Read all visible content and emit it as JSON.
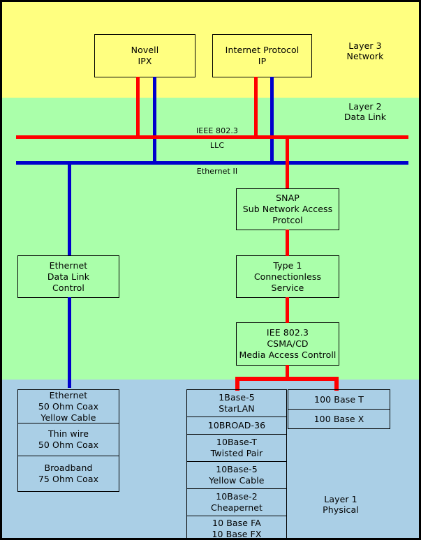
{
  "diagram": {
    "title": "Ethernet / IEEE 802.3 protocol stack",
    "colors": {
      "layer3_band": "#ffff80",
      "layer2_band": "#aaffaa",
      "layer1_band": "#aacfe6",
      "ieee8023_bus": "#ff0000",
      "ethernetII_bus": "#0000cc",
      "box_border": "#000000"
    }
  },
  "layers": [
    {
      "id": "layer3",
      "label": "Layer 3\nNetwork"
    },
    {
      "id": "layer2",
      "label": "Layer 2\nData Link"
    },
    {
      "id": "layer1",
      "label": "Layer 1\nPhysical"
    }
  ],
  "network_boxes": [
    {
      "id": "novell_ipx",
      "label": "Novell\nIPX"
    },
    {
      "id": "internet_protocol",
      "label": "Internet Protocol\nIP"
    }
  ],
  "buses": [
    {
      "id": "ieee8023_llc",
      "label_top": "IEEE 802.3",
      "label_bottom": "LLC",
      "color": "#ff0000"
    },
    {
      "id": "ethernet_ii",
      "label_bottom": "Ethernet II",
      "color": "#0000cc"
    }
  ],
  "datalink_boxes": [
    {
      "id": "snap",
      "label": "SNAP\nSub Network Access\nProtcol"
    },
    {
      "id": "ethernet_dlc",
      "label": "Ethernet\nData Link\nControl"
    },
    {
      "id": "type1",
      "label": "Type 1\nConnectionless\nService"
    },
    {
      "id": "mac",
      "label": "IEE 802.3\nCSMA/CD\nMedia Access Controll"
    }
  ],
  "physical_left_stack": [
    {
      "id": "eth_yellow",
      "label": "Ethernet\n50 Ohm Coax\nYellow Cable"
    },
    {
      "id": "thin_wire",
      "label": "Thin wire\n50 Ohm Coax"
    },
    {
      "id": "broadband",
      "label": "Broadband\n75 Ohm Coax"
    }
  ],
  "physical_mid_stack": [
    {
      "id": "starlan",
      "label": "1Base-5\nStarLAN"
    },
    {
      "id": "broad36",
      "label": "10BROAD-36"
    },
    {
      "id": "base_t",
      "label": "10Base-T\nTwisted Pair"
    },
    {
      "id": "base_5",
      "label": "10Base-5\nYellow Cable"
    },
    {
      "id": "base_2",
      "label": "10Base-2\nCheapernet"
    },
    {
      "id": "base_fa_fx",
      "label": "10 Base FA\n10 Base FX"
    }
  ],
  "physical_right_stack": [
    {
      "id": "hundred_base_t",
      "label": "100 Base T"
    },
    {
      "id": "hundred_base_x",
      "label": "100 Base X"
    }
  ]
}
